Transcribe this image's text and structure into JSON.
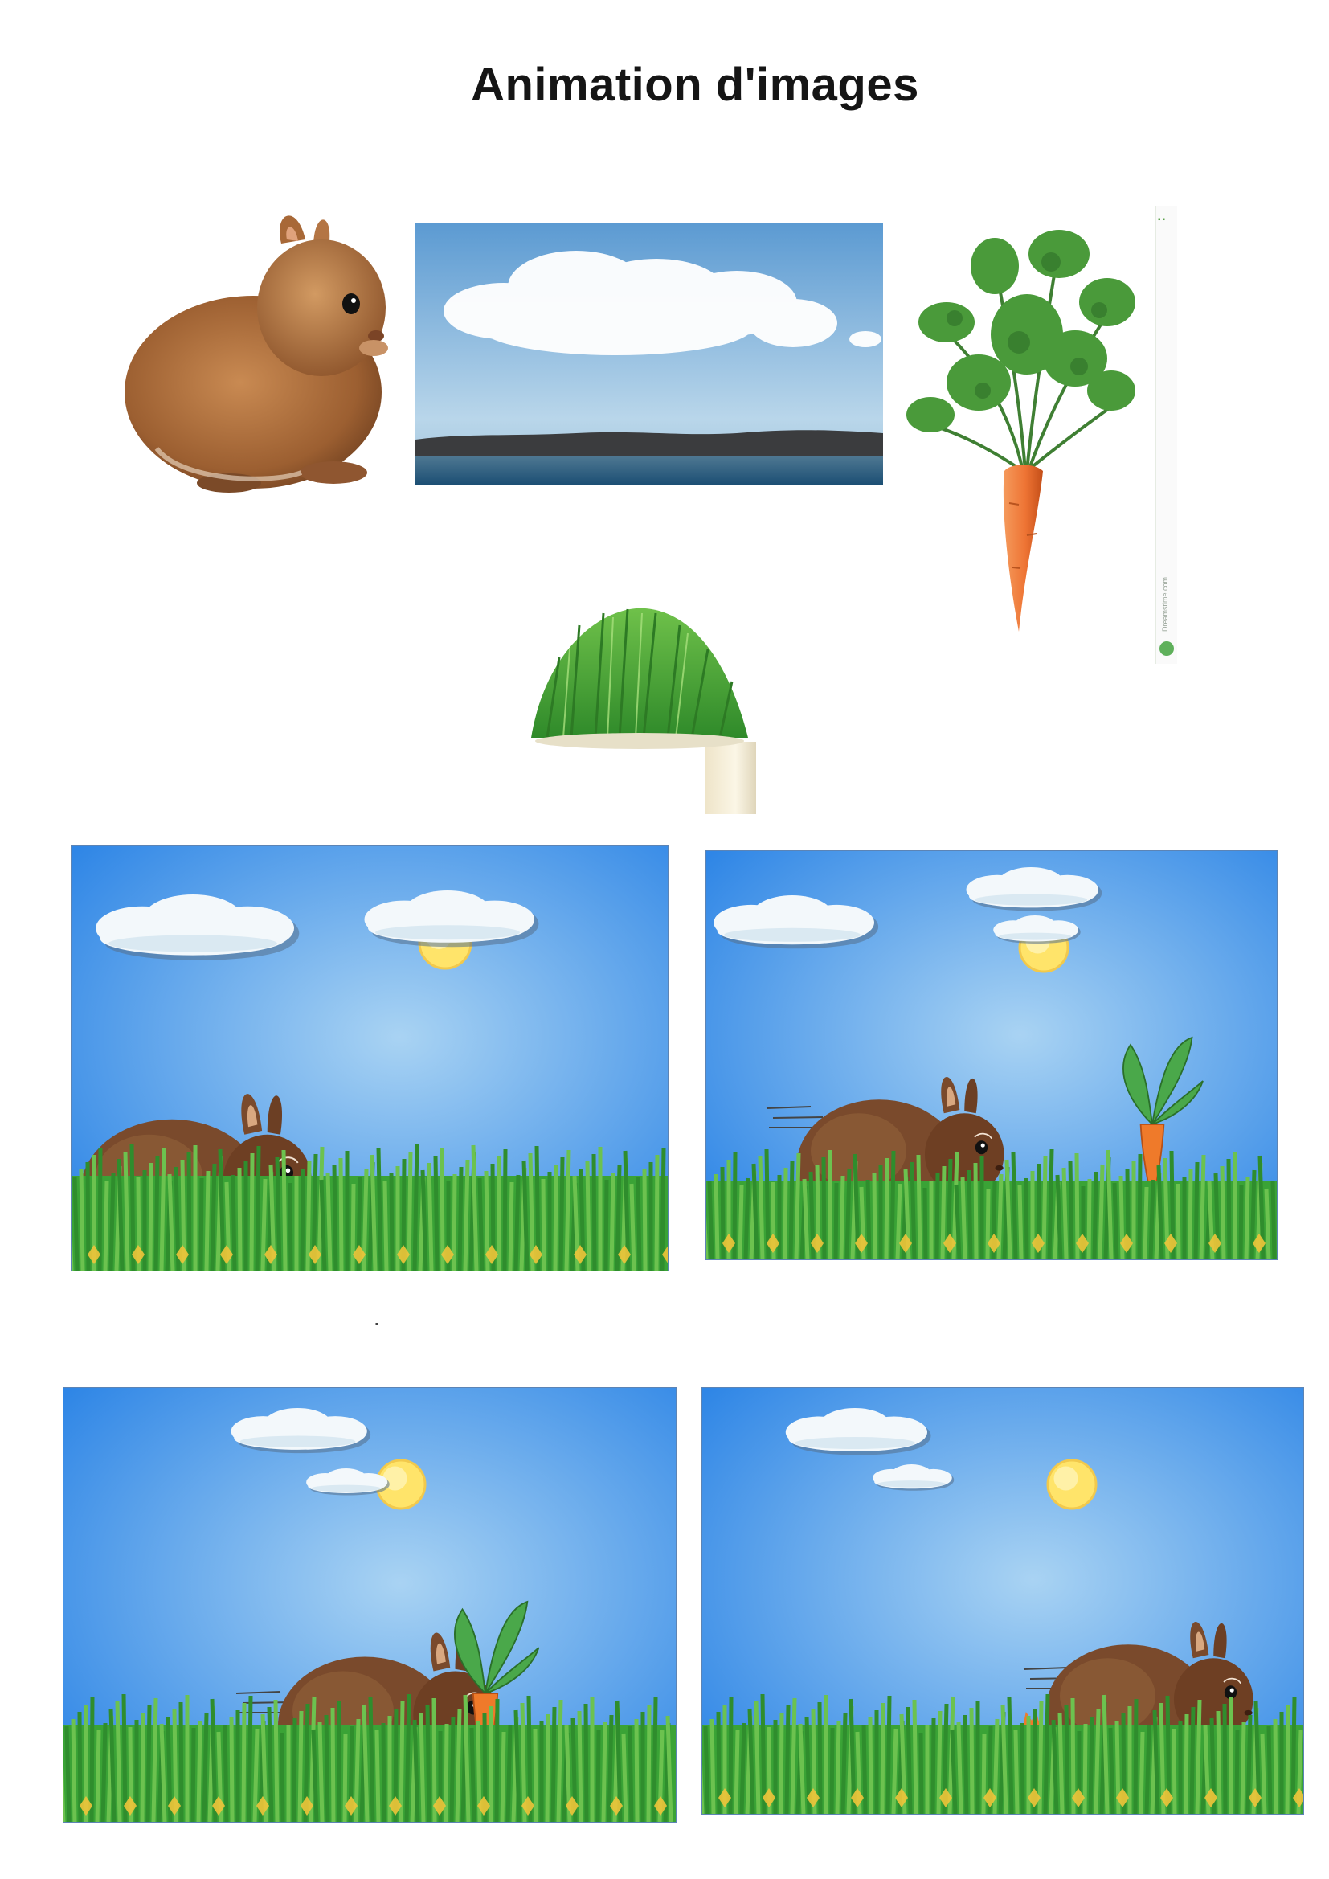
{
  "page": {
    "title": "Animation d'images"
  },
  "source_images": [
    {
      "name": "rabbit-photo"
    },
    {
      "name": "sky-cloud-photo"
    },
    {
      "name": "carrot-photo"
    },
    {
      "name": "grass-pot-photo"
    }
  ],
  "side_strip": {
    "text": "Dreamstime.com"
  },
  "frames": [
    {
      "index": 1,
      "rabbit": "left",
      "carrot": "none"
    },
    {
      "index": 2,
      "rabbit": "center",
      "carrot": "whole"
    },
    {
      "index": 3,
      "rabbit": "eating",
      "carrot": "being-eaten"
    },
    {
      "index": 4,
      "rabbit": "right",
      "carrot": "stub"
    }
  ],
  "colors": {
    "sky_top": "#2f86e6",
    "sky_bottom": "#a9d3f3",
    "grass": "#3aa336",
    "rabbit": "#7a4a2c",
    "sun": "#ffe46a",
    "carrot": "#ef7a2a",
    "title": "#151515"
  }
}
